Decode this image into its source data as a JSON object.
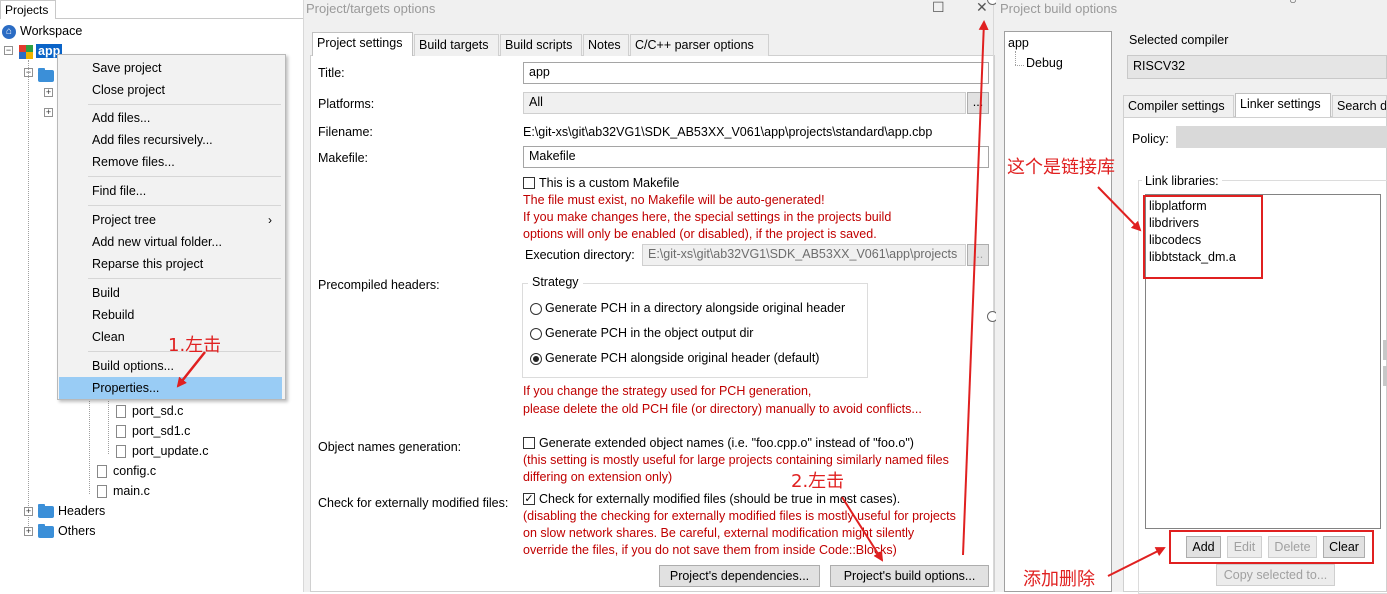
{
  "left_panel": {
    "tab_label": "Projects",
    "workspace_label": "Workspace",
    "project_label": "app",
    "files": [
      "port_sd.c",
      "port_sd1.c",
      "port_update.c",
      "config.c",
      "main.c"
    ],
    "folders": [
      "Headers",
      "Others"
    ]
  },
  "context_menu": {
    "items": [
      "Save project",
      "Close project",
      "Add files...",
      "Add files recursively...",
      "Remove files...",
      "Find file...",
      "Project tree",
      "Add new virtual folder...",
      "Reparse this project",
      "Build",
      "Rebuild",
      "Clean",
      "Build options...",
      "Properties..."
    ],
    "highlighted": "Properties..."
  },
  "annotations": {
    "step1": "1.左击",
    "step2": "2.左击",
    "link_libs_note": "这个是链接库",
    "add_delete_note": "添加删除"
  },
  "targets_dialog": {
    "title": "Project/targets options",
    "tabs": [
      "Project settings",
      "Build targets",
      "Build scripts",
      "Notes",
      "C/C++ parser options"
    ],
    "active_tab": "Project settings",
    "title_label": "Title:",
    "title_value": "app",
    "platforms_label": "Platforms:",
    "platforms_value": "All",
    "ellipsis": "...",
    "filename_label": "Filename:",
    "filename_value": "E:\\git-xs\\git\\ab32VG1\\SDK_AB53XX_V061\\app\\projects\\standard\\app.cbp",
    "makefile_label": "Makefile:",
    "makefile_value": "Makefile",
    "custom_makefile_label": "This is a custom Makefile",
    "makefile_warning": [
      "The file must exist, no Makefile will be auto-generated!",
      "If you make changes here, the special settings in the projects build",
      "options will only be enabled (or disabled), if the project is saved."
    ],
    "exec_dir_label": "Execution directory:",
    "exec_dir_value": "E:\\git-xs\\git\\ab32VG1\\SDK_AB53XX_V061\\app\\projects",
    "pch_label": "Precompiled headers:",
    "strategy_label": "Strategy",
    "pch_options": [
      "Generate PCH in a directory alongside original header",
      "Generate PCH in the object output dir",
      "Generate PCH alongside original header (default)"
    ],
    "pch_selected": 2,
    "pch_note": [
      "If you change the strategy used for PCH generation,",
      "please delete the old PCH file (or directory) manually to avoid conflicts..."
    ],
    "obj_names_label": "Object names generation:",
    "obj_names_check": "Generate extended object names (i.e. \"foo.cpp.o\" instead of \"foo.o\")",
    "obj_names_note": [
      "(this setting is mostly useful for large projects containing similarly named files",
      "differing on extension only)"
    ],
    "ext_mod_label": "Check for externally modified files:",
    "ext_mod_check": "Check for externally modified files (should be true in most cases).",
    "ext_mod_note": [
      "(disabling the checking for externally modified files is mostly useful for projects",
      "on slow network shares. Be careful, external modification might silently",
      "override the files, if you do not save them from inside Code::Blocks)"
    ],
    "deps_button": "Project's dependencies...",
    "build_opts_button": "Project's build options..."
  },
  "build_options_dialog": {
    "title": "Project build options",
    "targets": [
      "app",
      "Debug"
    ],
    "selected_compiler_label": "Selected compiler",
    "selected_compiler": "RISCV32",
    "tabs": [
      "Compiler settings",
      "Linker settings",
      "Search d"
    ],
    "active_tab": "Linker settings",
    "policy_label": "Policy:",
    "link_libraries_label": "Link libraries:",
    "libraries": [
      "libplatform",
      "libdrivers",
      "libcodecs",
      "libbtstack_dm.a"
    ],
    "buttons": [
      "Add",
      "Edit",
      "Delete",
      "Clear"
    ],
    "copy_button": "Copy selected to..."
  },
  "colors": {
    "annotation_red": "#e02020",
    "warning_red": "#c00000",
    "selection_blue": "#99ccf5"
  }
}
